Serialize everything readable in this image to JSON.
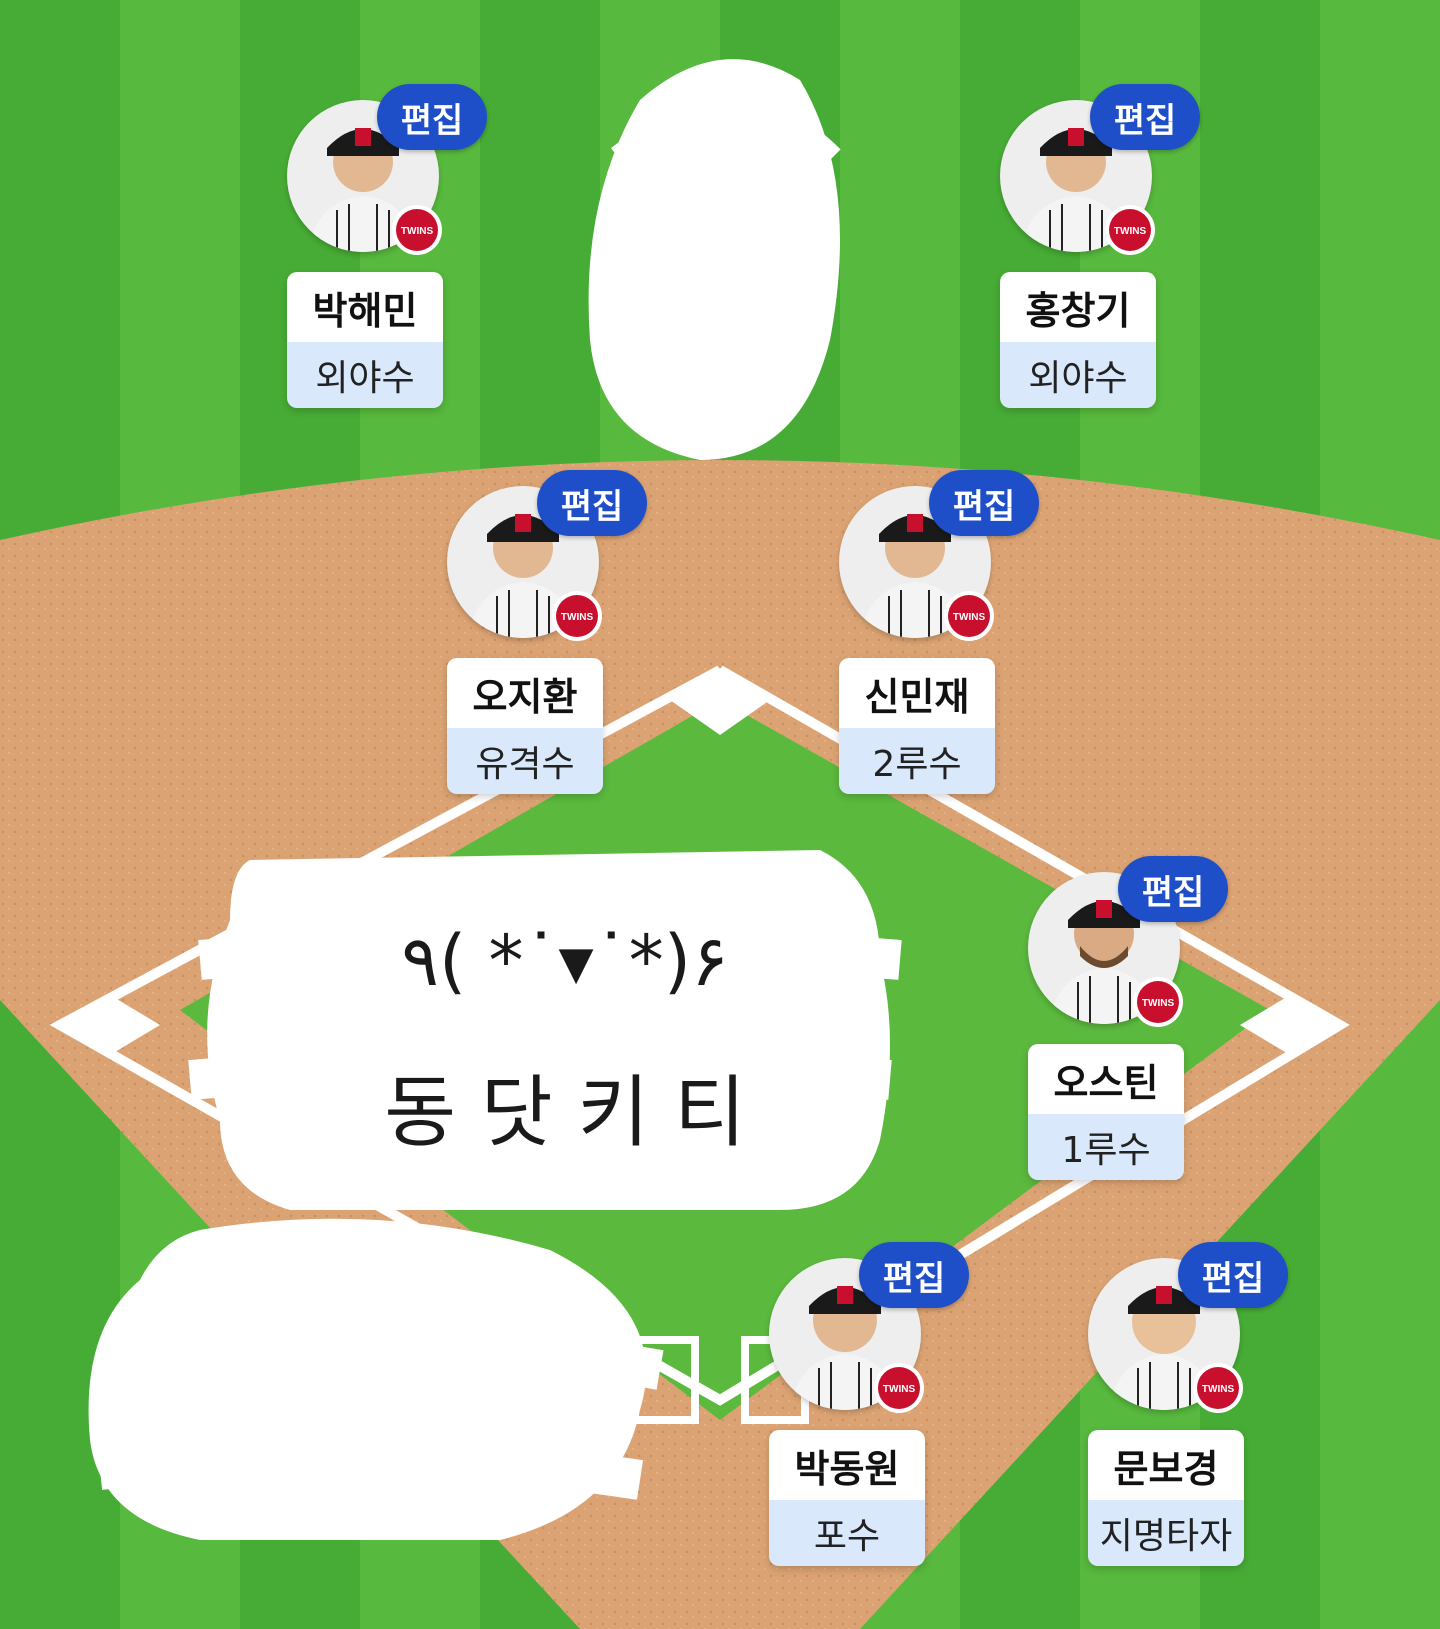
{
  "edit_label": "편집",
  "colors": {
    "grass_dark": "#3fa52f",
    "grass_light": "#66c445",
    "dirt": "#dba373",
    "edit_button": "#1f4fc8",
    "position_bg": "#d9e8fa",
    "team_logo": "#c8102e"
  },
  "players": [
    {
      "id": "lf",
      "name": "박해민",
      "position": "외야수"
    },
    {
      "id": "rf",
      "name": "홍창기",
      "position": "외야수"
    },
    {
      "id": "ss",
      "name": "오지환",
      "position": "유격수"
    },
    {
      "id": "2b",
      "name": "신민재",
      "position": "2루수"
    },
    {
      "id": "1b",
      "name": "오스틴",
      "position": "1루수"
    },
    {
      "id": "c",
      "name": "박동원",
      "position": "포수"
    },
    {
      "id": "dh",
      "name": "문보경",
      "position": "지명타자"
    }
  ],
  "overlay": {
    "emoticon": "٩( *˙▾˙*)۶",
    "caption": "동 닷 키 티"
  },
  "team_logo_text": "TWINS"
}
